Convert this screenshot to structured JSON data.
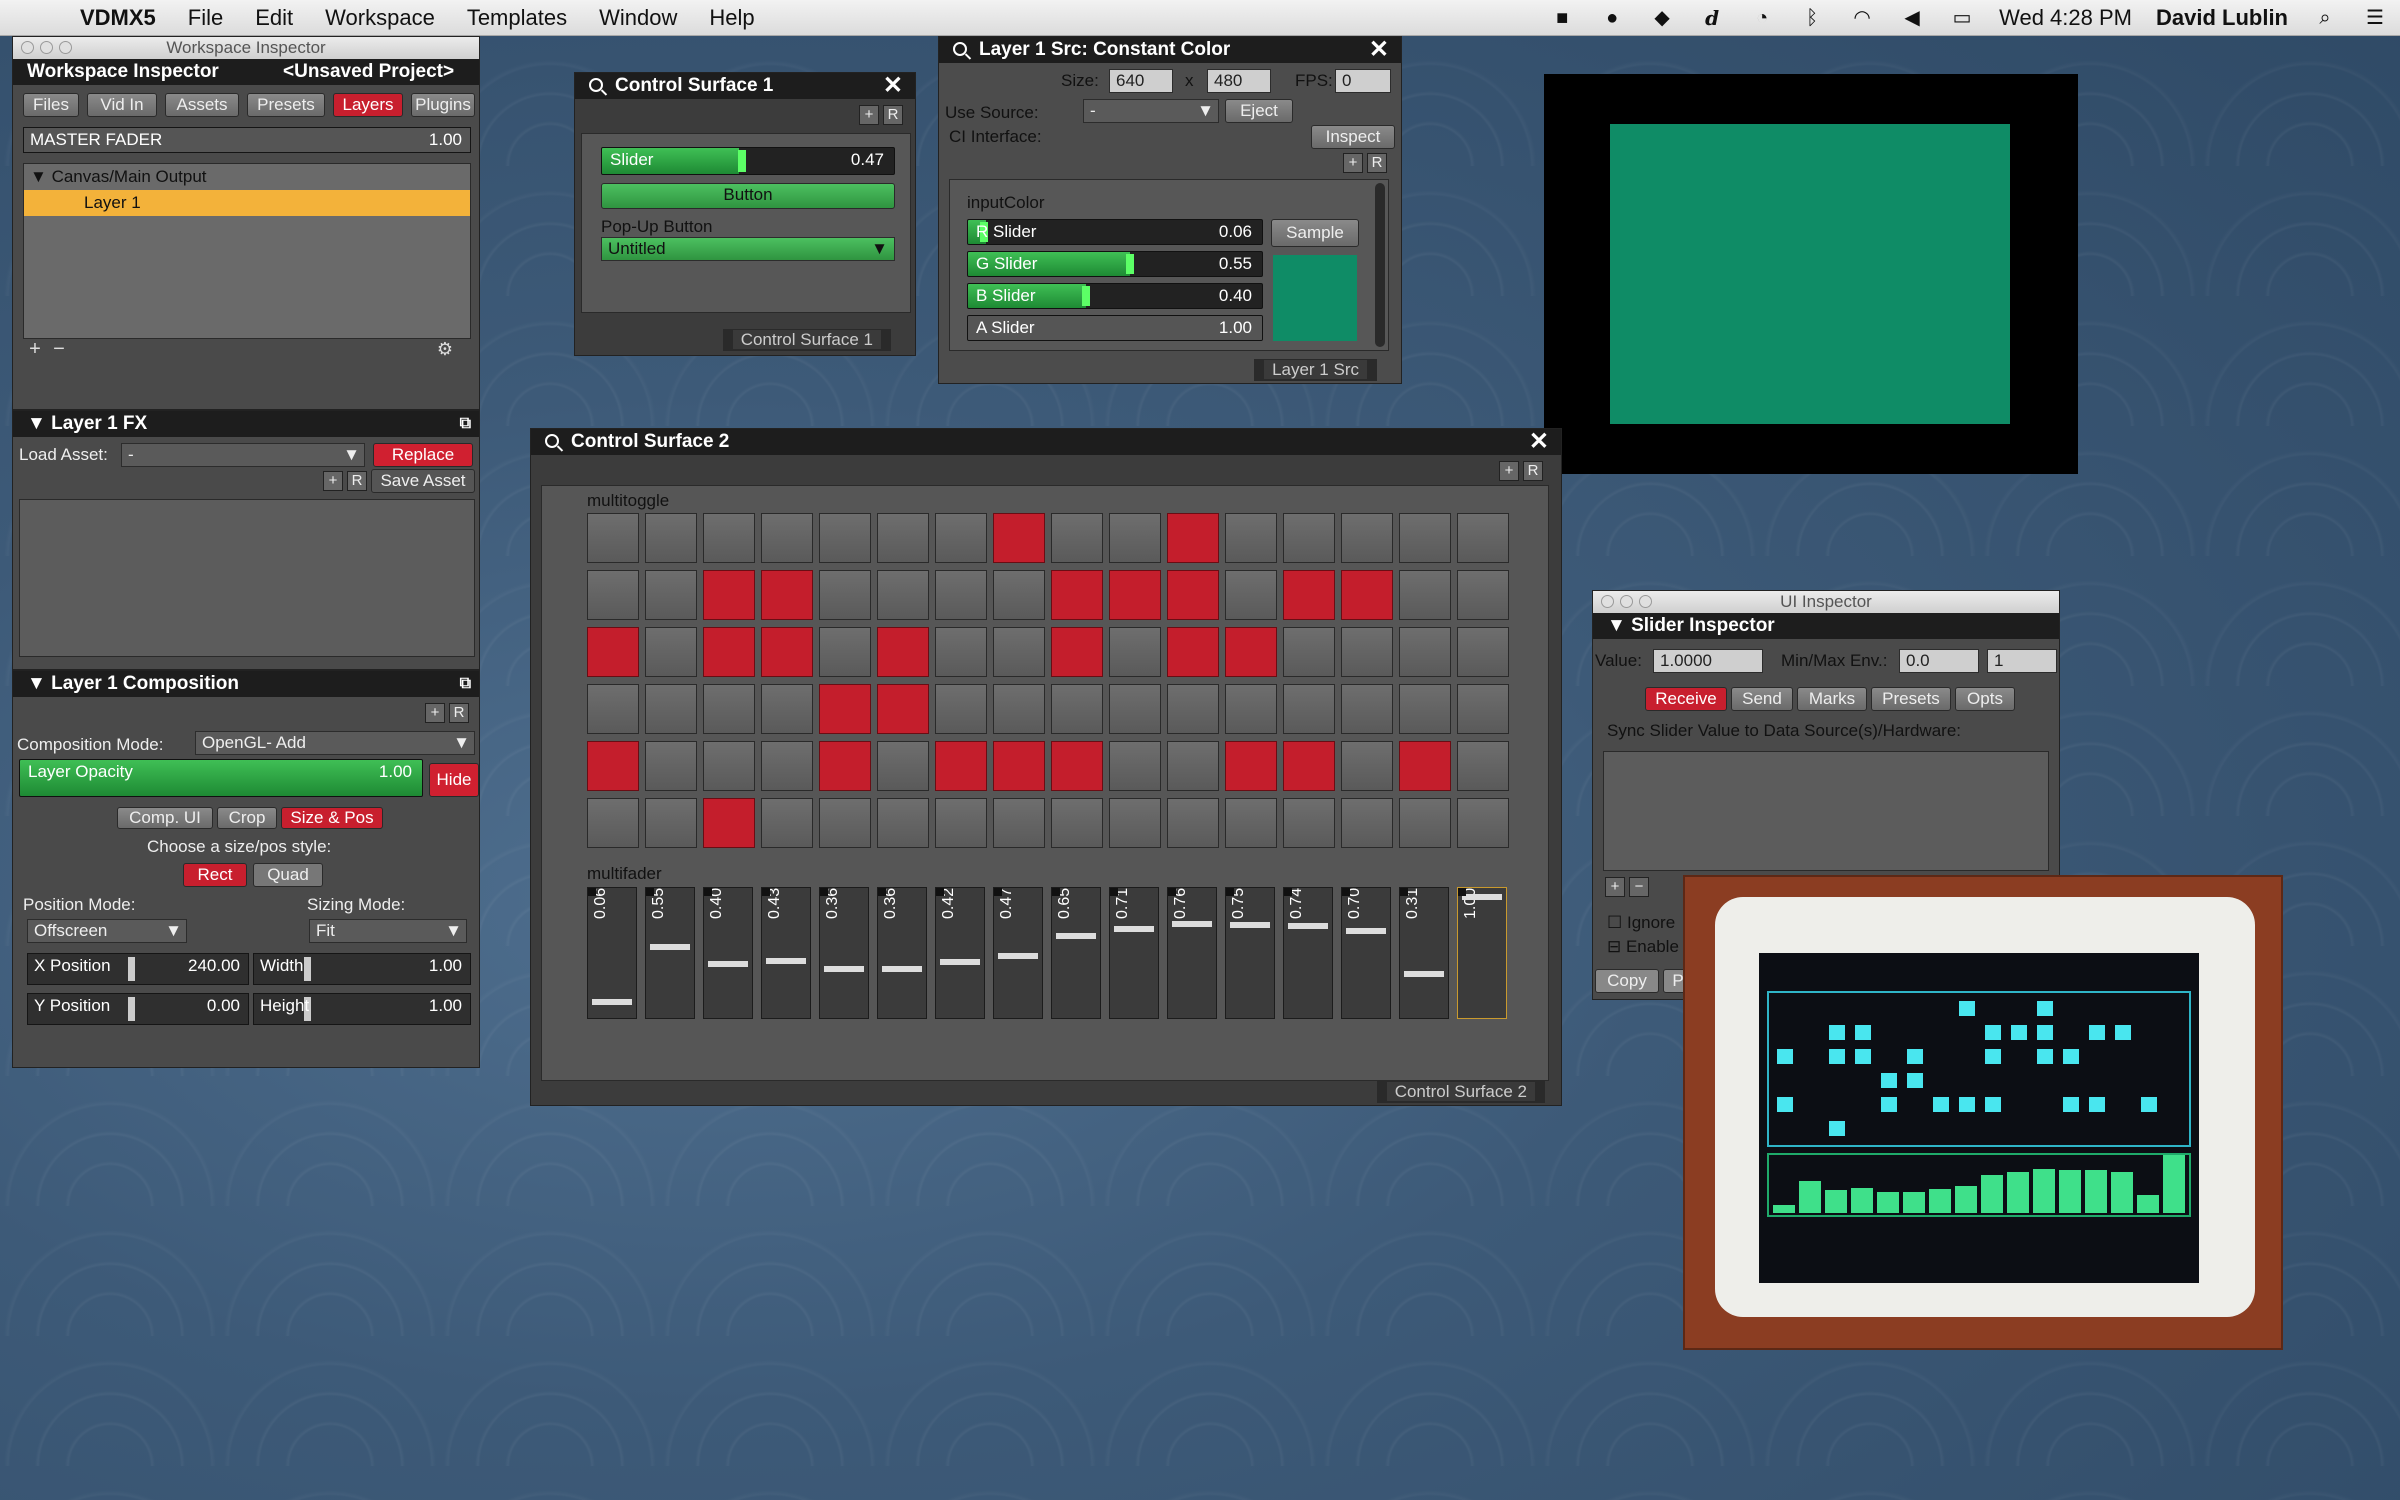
{
  "menubar": {
    "app": "VDMX5",
    "items": [
      "File",
      "Edit",
      "Workspace",
      "Templates",
      "Window",
      "Help"
    ],
    "clock": "Wed 4:28 PM",
    "user": "David Lublin"
  },
  "workspace_inspector": {
    "window_title": "Workspace Inspector",
    "title": "Workspace Inspector",
    "project": "<Unsaved Project>",
    "tabs": [
      "Files",
      "Vid In",
      "Assets",
      "Presets",
      "Layers",
      "Plugins"
    ],
    "active_tab": "Layers",
    "master_label": "MASTER FADER",
    "master_value": "1.00",
    "tree_group": "Canvas/Main Output",
    "tree_item": "Layer 1"
  },
  "layer_fx": {
    "title": "Layer 1 FX",
    "load_label": "Load Asset:",
    "load_value": "-",
    "replace": "Replace",
    "save_asset": "Save Asset"
  },
  "composition": {
    "title": "Layer 1 Composition",
    "mode_label": "Composition Mode:",
    "mode_value": "OpenGL- Add",
    "opacity_label": "Layer Opacity",
    "opacity_value": "1.00",
    "opacity_level": 1.0,
    "hide": "Hide",
    "tabs": [
      "Comp. UI",
      "Crop",
      "Size & Pos"
    ],
    "active_tab": "Size & Pos",
    "style_prompt": "Choose a size/pos style:",
    "styles": [
      "Rect",
      "Quad"
    ],
    "active_style": "Rect",
    "position_mode_label": "Position Mode:",
    "position_mode": "Offscreen",
    "sizing_mode_label": "Sizing Mode:",
    "sizing_mode": "Fit",
    "x_label": "X Position",
    "x_value": "240.00",
    "w_label": "Width",
    "w_value": "1.00",
    "y_label": "Y Position",
    "y_value": "0.00",
    "h_label": "Height",
    "h_value": "1.00"
  },
  "cs1": {
    "title": "Control Surface 1",
    "slider_label": "Slider",
    "slider_value": "0.47",
    "slider_level": 0.47,
    "button": "Button",
    "popup_label": "Pop-Up Button",
    "popup_value": "Untitled",
    "footer": "Control Surface 1"
  },
  "src": {
    "title": "Layer 1 Src: Constant Color",
    "size_label": "Size:",
    "w": "640",
    "x": "x",
    "h": "480",
    "fps_label": "FPS:",
    "fps": "0",
    "use_source_label": "Use Source:",
    "use_source": "-",
    "eject": "Eject",
    "ci_label": "CI Interface:",
    "inspect": "Inspect",
    "color_label": "inputColor",
    "sliders": [
      {
        "label": "R Slider",
        "value": "0.06",
        "level": 0.06
      },
      {
        "label": "G Slider",
        "value": "0.55",
        "level": 0.55
      },
      {
        "label": "B Slider",
        "value": "0.40",
        "level": 0.4
      },
      {
        "label": "A Slider",
        "value": "1.00",
        "level": 1.0
      }
    ],
    "sample": "Sample",
    "footer": "Layer 1 Src",
    "color": "#0f8c66"
  },
  "cs2": {
    "title": "Control Surface 2",
    "toggle_label": "multitoggle",
    "fader_label": "multifader",
    "footer": "Control Surface 2",
    "toggles": [
      [
        0,
        0,
        0,
        0,
        0,
        0,
        0,
        1,
        0,
        0,
        1,
        0,
        0,
        0,
        0,
        0
      ],
      [
        0,
        0,
        1,
        1,
        0,
        0,
        0,
        0,
        1,
        1,
        1,
        0,
        1,
        1,
        0,
        0
      ],
      [
        1,
        0,
        1,
        1,
        0,
        1,
        0,
        0,
        1,
        0,
        1,
        1,
        0,
        0,
        0,
        0
      ],
      [
        0,
        0,
        0,
        0,
        1,
        1,
        0,
        0,
        0,
        0,
        0,
        0,
        0,
        0,
        0,
        0
      ],
      [
        1,
        0,
        0,
        0,
        1,
        0,
        1,
        1,
        1,
        0,
        0,
        1,
        1,
        0,
        1,
        0
      ],
      [
        0,
        0,
        1,
        0,
        0,
        0,
        0,
        0,
        0,
        0,
        0,
        0,
        0,
        0,
        0,
        0
      ]
    ],
    "faders": [
      "0.06",
      "0.55",
      "0.40",
      "0.43",
      "0.36",
      "0.36",
      "0.42",
      "0.47",
      "0.65",
      "0.71",
      "0.76",
      "0.75",
      "0.74",
      "0.70",
      "0.31",
      "1.00"
    ]
  },
  "ui_inspector": {
    "window_title": "UI Inspector",
    "title": "Slider Inspector",
    "value_label": "Value:",
    "value": "1.0000",
    "env_label": "Min/Max Env.:",
    "env_min": "0.0",
    "env_max": "1",
    "tabs": [
      "Receive",
      "Send",
      "Marks",
      "Presets",
      "Opts"
    ],
    "active_tab": "Receive",
    "sync_label": "Sync Slider Value to Data Source(s)/Hardware:",
    "ignore": "Ignore",
    "enable": "Enable",
    "copy": "Copy",
    "p": "P"
  },
  "colors": {
    "red": "#c41e2c",
    "green": "#1e8a34",
    "output": "#0f8c66"
  }
}
